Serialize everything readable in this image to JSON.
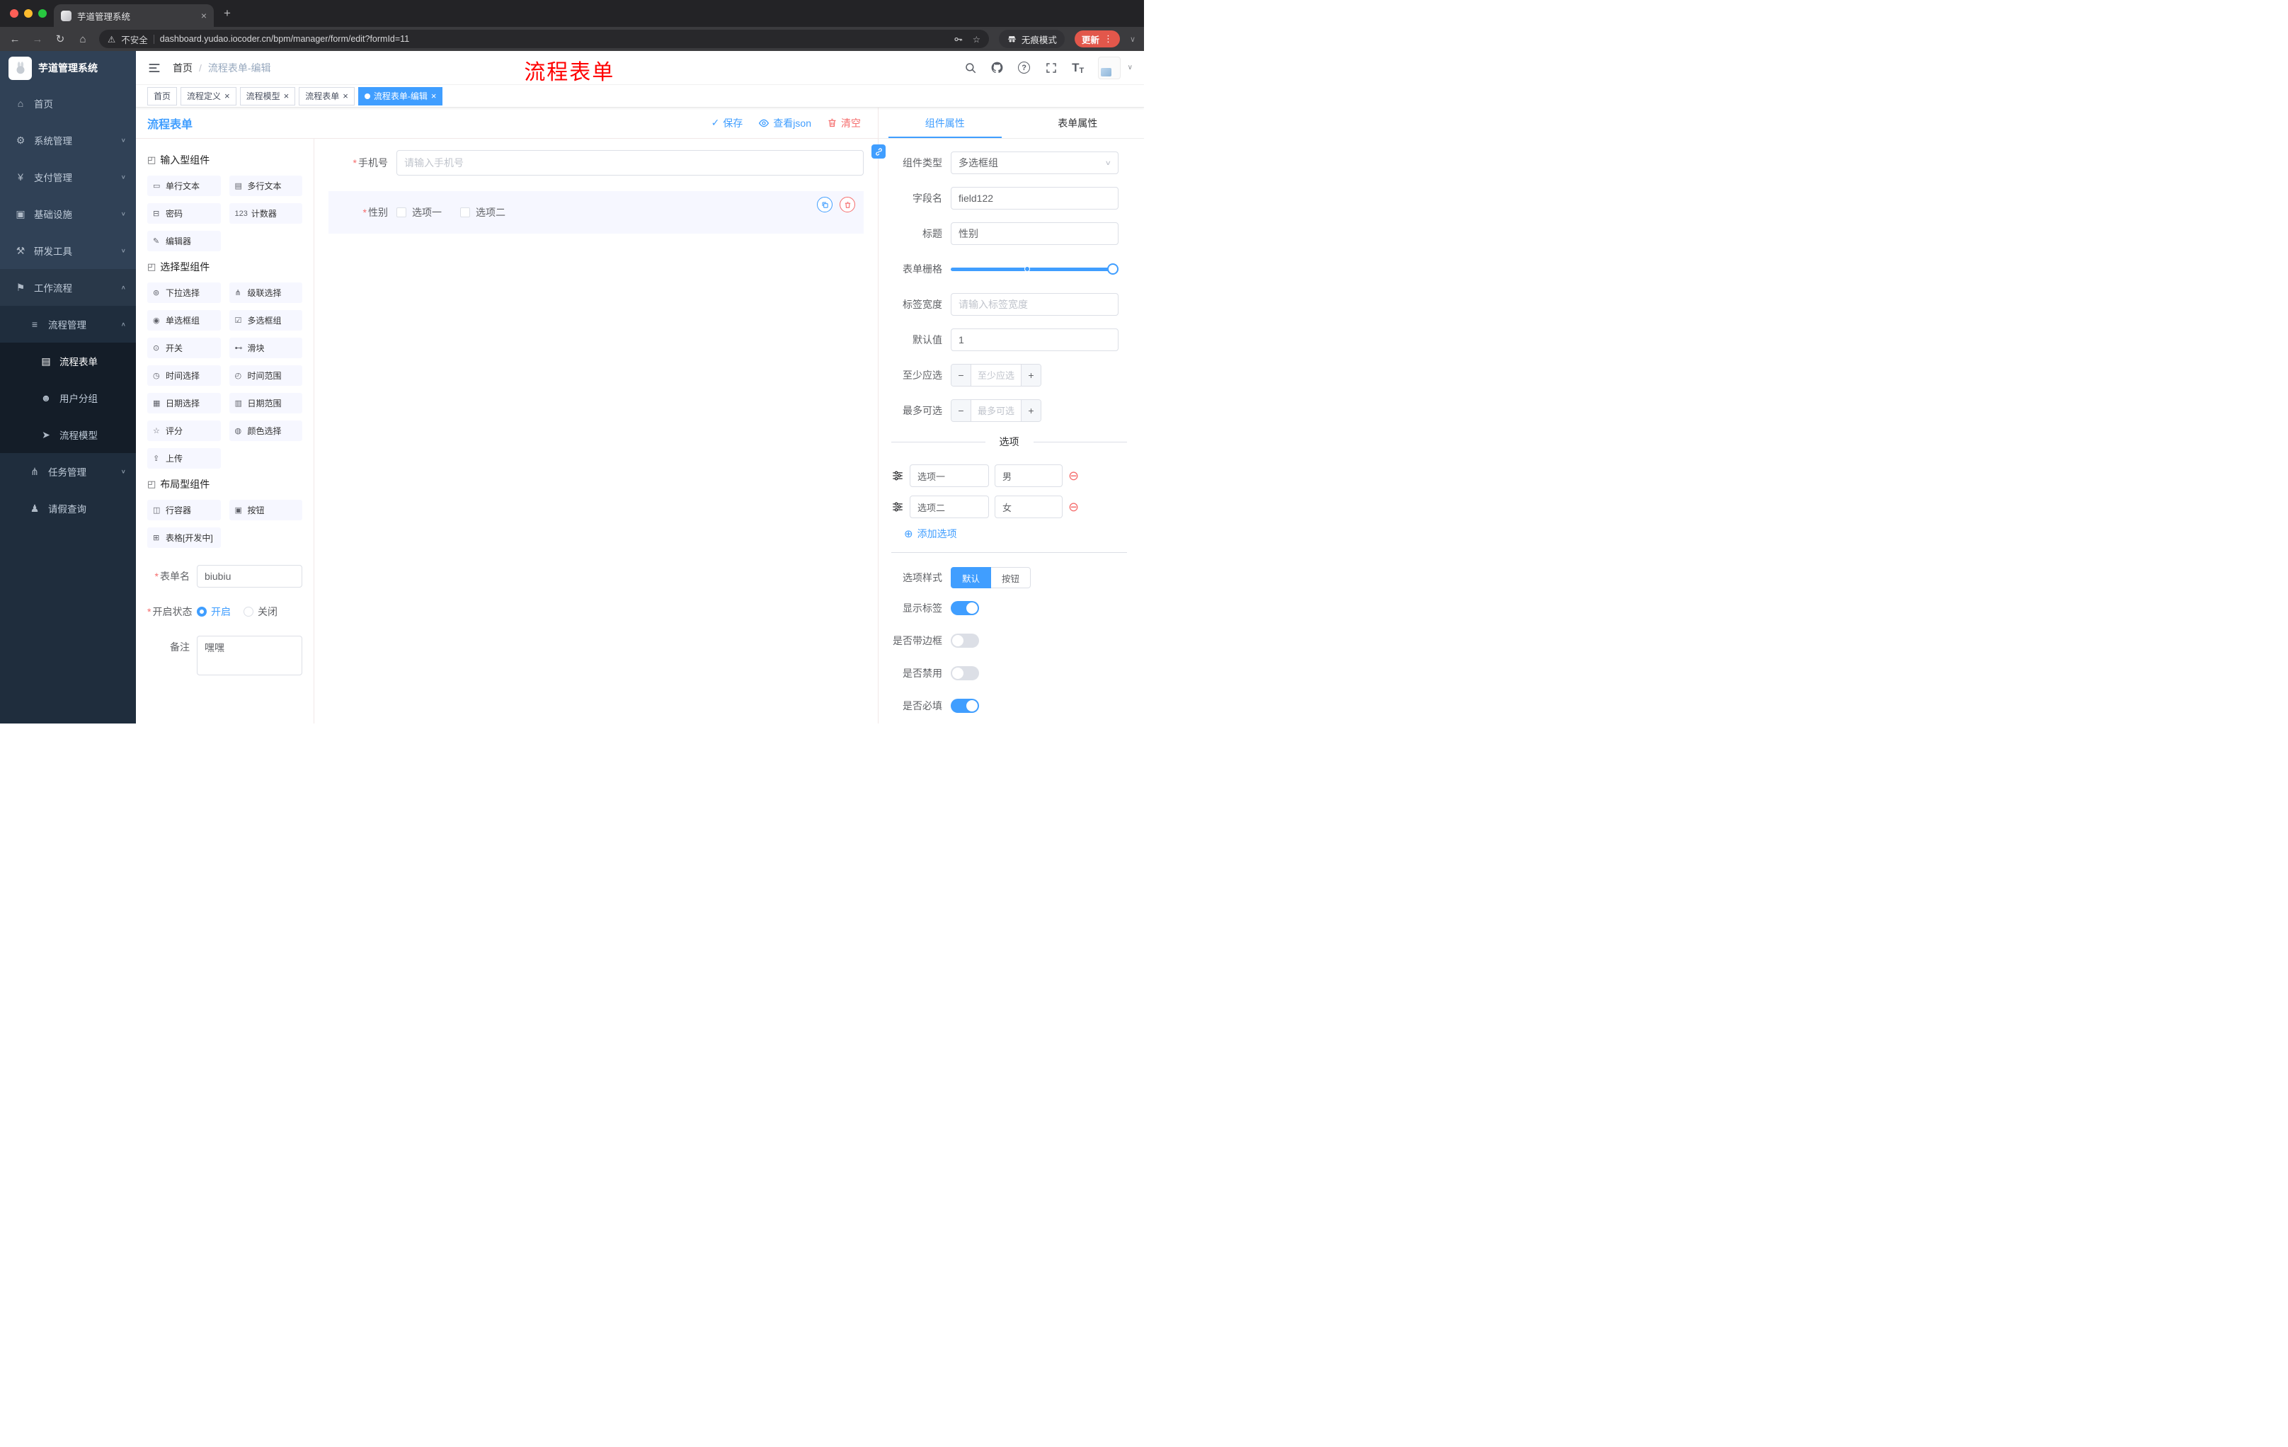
{
  "colors": {
    "accent": "#409eff",
    "danger": "#f56c6c",
    "annotation_red": "#ff0000",
    "sidebar_bg": "#304156",
    "sidebar_submenu_bg": "#1f2d3d",
    "selected_component_bg": "#f6f7ff",
    "update_button": "#e2574b"
  },
  "icons": {
    "home": "⌂",
    "system": "⚙",
    "payment": "¥",
    "infra": "▣",
    "devtools": "⚒",
    "workflow": "⚑",
    "process": "≡",
    "form-doc": "▤",
    "user-group": "☻",
    "model": "➤",
    "task": "⋔",
    "leave": "♟",
    "chev-down": "∨",
    "chev-up": "∧",
    "text-input": "▭",
    "textarea": "▤",
    "password": "⊟",
    "counter": "123",
    "editor": "✎",
    "dropdown": "⊚",
    "cascader": "⋔",
    "radio-group": "◉",
    "checkbox-group": "☑",
    "switch": "⊙",
    "slider": "⊷",
    "time-picker": "◷",
    "time-range": "◴",
    "date-picker": "▦",
    "date-range": "▥",
    "rate": "☆",
    "color-picker": "◍",
    "upload": "⇪",
    "row-container": "◫",
    "button": "▣",
    "table": "⊞",
    "section": "◰",
    "back": "←",
    "forward": "→",
    "reload": "↻",
    "warning": "⚠",
    "star": "☆",
    "check": "✓",
    "plus": "+",
    "minus": "−",
    "dots": "⋮",
    "circle-plus": "⊕",
    "circle-minus": "⊖",
    "close": "×",
    "question": "?",
    "font": "T"
  },
  "browser": {
    "tab_title": "芋道管理系统",
    "security": "不安全",
    "url": "dashboard.yudao.iocoder.cn/bpm/manager/form/edit?formId=11",
    "incognito": "无痕模式",
    "update": "更新"
  },
  "sidebar": {
    "title": "芋道管理系统",
    "menu": [
      {
        "label": "首页",
        "icon": "home",
        "level": 0
      },
      {
        "label": "系统管理",
        "icon": "system",
        "level": 0,
        "chevron": "down"
      },
      {
        "label": "支付管理",
        "icon": "payment",
        "level": 0,
        "chevron": "down"
      },
      {
        "label": "基础设施",
        "icon": "infra",
        "level": 0,
        "chevron": "down"
      },
      {
        "label": "研发工具",
        "icon": "devtools",
        "level": 0,
        "chevron": "down"
      },
      {
        "label": "工作流程",
        "icon": "workflow",
        "level": 0,
        "chevron": "up",
        "bg": "mid"
      },
      {
        "label": "流程管理",
        "icon": "process",
        "level": 1,
        "chevron": "up",
        "bg": "dark"
      },
      {
        "label": "流程表单",
        "icon": "form-doc",
        "level": 2,
        "bg": "darker",
        "active": true
      },
      {
        "label": "用户分组",
        "icon": "user-group",
        "level": 2,
        "bg": "darker"
      },
      {
        "label": "流程模型",
        "icon": "model",
        "level": 2,
        "bg": "darker"
      },
      {
        "label": "任务管理",
        "icon": "task",
        "level": 1,
        "chevron": "down",
        "bg": "dark"
      },
      {
        "label": "请假查询",
        "icon": "leave",
        "level": 1,
        "bg": "dark"
      }
    ]
  },
  "header": {
    "breadcrumb_home": "首页",
    "separator": "/",
    "breadcrumb_current": "流程表单-编辑",
    "annotation": "流程表单"
  },
  "tags": [
    {
      "label": "首页",
      "closable": false,
      "active": false
    },
    {
      "label": "流程定义",
      "closable": true,
      "active": false
    },
    {
      "label": "流程模型",
      "closable": true,
      "active": false
    },
    {
      "label": "流程表单",
      "closable": true,
      "active": false
    },
    {
      "label": "流程表单-编辑",
      "closable": true,
      "active": true
    }
  ],
  "board": {
    "title": "流程表单",
    "save": "保存",
    "view_json": "查看json",
    "clear": "清空"
  },
  "palette": {
    "sections": [
      {
        "title": "输入型组件",
        "items": [
          {
            "label": "单行文本",
            "icon": "text-input"
          },
          {
            "label": "多行文本",
            "icon": "textarea"
          },
          {
            "label": "密码",
            "icon": "password"
          },
          {
            "label": "计数器",
            "icon": "counter"
          },
          {
            "label": "编辑器",
            "icon": "editor"
          }
        ]
      },
      {
        "title": "选择型组件",
        "items": [
          {
            "label": "下拉选择",
            "icon": "dropdown"
          },
          {
            "label": "级联选择",
            "icon": "cascader"
          },
          {
            "label": "单选框组",
            "icon": "radio-group"
          },
          {
            "label": "多选框组",
            "icon": "checkbox-group"
          },
          {
            "label": "开关",
            "icon": "switch"
          },
          {
            "label": "滑块",
            "icon": "slider"
          },
          {
            "label": "时间选择",
            "icon": "time-picker"
          },
          {
            "label": "时间范围",
            "icon": "time-range"
          },
          {
            "label": "日期选择",
            "icon": "date-picker"
          },
          {
            "label": "日期范围",
            "icon": "date-range"
          },
          {
            "label": "评分",
            "icon": "rate"
          },
          {
            "label": "颜色选择",
            "icon": "color-picker"
          },
          {
            "label": "上传",
            "icon": "upload"
          }
        ]
      },
      {
        "title": "布局型组件",
        "items": [
          {
            "label": "行容器",
            "icon": "row-container"
          },
          {
            "label": "按钮",
            "icon": "button"
          },
          {
            "label": "表格[开发中]",
            "icon": "table"
          }
        ]
      }
    ]
  },
  "palette_form": {
    "name_label": "表单名",
    "name_value": "biubiu",
    "status_label": "开启状态",
    "status_on": "开启",
    "status_off": "关闭",
    "remark_label": "备注",
    "remark_value": "嘿嘿"
  },
  "canvas": {
    "phone_label": "手机号",
    "phone_placeholder": "请输入手机号",
    "gender_label": "性别",
    "gender_options": [
      "选项一",
      "选项二"
    ]
  },
  "inspector": {
    "tab_component": "组件属性",
    "tab_form": "表单属性",
    "rows": {
      "type_label": "组件类型",
      "type_value": "多选框组",
      "field_label": "字段名",
      "field_value": "field122",
      "title_label": "标题",
      "title_value": "性别",
      "grid_label": "表单栅格",
      "width_label": "标签宽度",
      "width_placeholder": "请输入标签宽度",
      "default_label": "默认值",
      "default_value": "1",
      "min_label": "至少应选",
      "min_placeholder": "至少应选",
      "max_label": "最多可选",
      "max_placeholder": "最多可选"
    },
    "options_title": "选项",
    "options": [
      {
        "label": "选项一",
        "value": "男"
      },
      {
        "label": "选项二",
        "value": "女"
      }
    ],
    "add_option": "添加选项",
    "style_label": "选项样式",
    "style_default": "默认",
    "style_button": "按钮",
    "switches": [
      {
        "label": "显示标签",
        "on": true
      },
      {
        "label": "是否带边框",
        "on": false
      },
      {
        "label": "是否禁用",
        "on": false
      },
      {
        "label": "是否必填",
        "on": true
      }
    ]
  },
  "misc": {
    "star": "*"
  }
}
